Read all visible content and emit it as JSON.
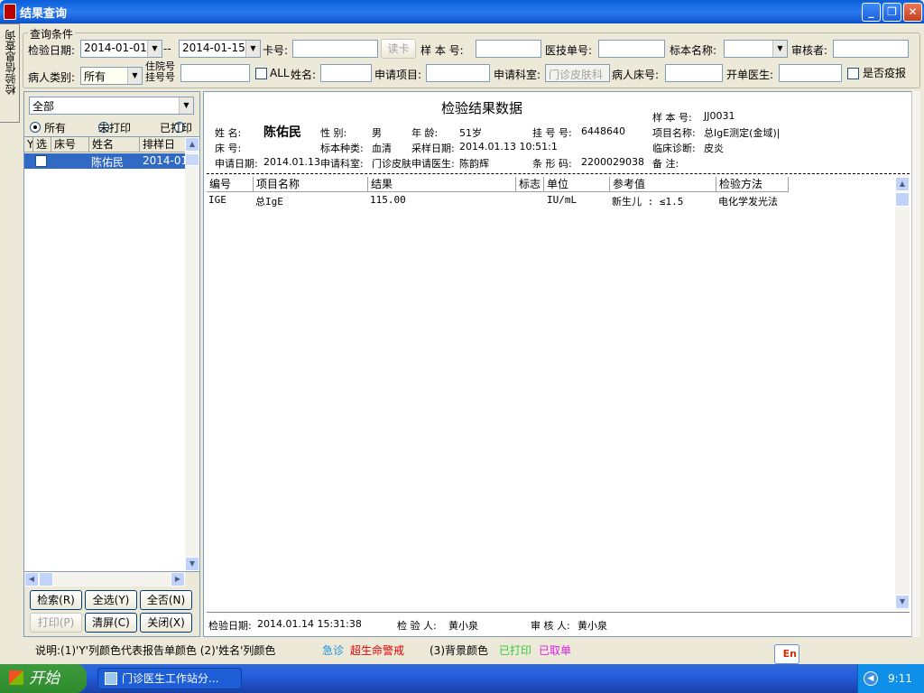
{
  "window": {
    "title": "结果查询",
    "minimize": "_",
    "maximize": "❐",
    "close": "✕"
  },
  "side_tab": "检验信息查询",
  "cond": {
    "legend": "查询条件",
    "date_label": "检验日期:",
    "date_from": "2014-01-01",
    "date_sep": "--",
    "date_to": "2014-01-15",
    "card_label": "卡号:",
    "card_value": "",
    "read_card": "读卡",
    "sample_label": "样 本 号:",
    "sample_value": "",
    "yj_label": "医技单号:",
    "yj_value": "",
    "specimen_name_label": "标本名称:",
    "specimen_name_value": "",
    "reviewer_label": "审核者:",
    "reviewer_value": "",
    "patient_type_label": "病人类别:",
    "patient_type_value": "所有",
    "inpatient_label_1": "住院号",
    "inpatient_label_2": "挂号号",
    "inpatient_value": "",
    "all_label": "ALL",
    "name_label": "姓名:",
    "name_value": "",
    "apply_item_label": "申请项目:",
    "apply_item_value": "",
    "apply_dept_label": "申请科室:",
    "apply_dept_value": "门诊皮肤科",
    "bed_label": "病人床号:",
    "bed_value": "",
    "doctor_label": "开单医生:",
    "doctor_value": "",
    "epidemic_label": "是否疫报"
  },
  "left": {
    "filter_value": "全部",
    "radio_all": "所有",
    "radio_unprinted": "未打印",
    "radio_printed": "已打印",
    "columns": [
      "Y",
      "选",
      "床号",
      "姓名",
      "排样日"
    ],
    "rows": [
      {
        "y": "",
        "bed": "",
        "name": "陈佑民",
        "date": "2014-01"
      }
    ],
    "buttons": {
      "search": "检索(R)",
      "select_all": "全选(Y)",
      "select_none": "全否(N)",
      "print": "打印(P)",
      "clear": "清屏(C)",
      "close": "关闭(X)"
    }
  },
  "report": {
    "title": "检验结果数据",
    "sample_no_label": "样 本 号:",
    "sample_no": "JJ0031",
    "name_label": "姓    名:",
    "name": "陈佑民",
    "sex_label": "性    别:",
    "sex": "男",
    "age_label": "年    龄:",
    "age": "51岁",
    "reg_label": "挂 号 号:",
    "reg": "6448640",
    "item_label": "项目名称:",
    "item": "总IgE测定(金域)|",
    "bed_label": "床    号:",
    "bed": "",
    "specimen_label": "标本种类:",
    "specimen": "血清",
    "collect_label": "采样日期:",
    "collect": "2014.01.13 10:51:1",
    "diag_label": "临床诊断:",
    "diag": "皮炎",
    "apply_date_label": "申请日期:",
    "apply_date": "2014.01.13",
    "apply_dept_label": "申请科室:",
    "apply_dept": "门诊皮肤",
    "apply_doc_label": "申请医生:",
    "apply_doc": "陈韵辉",
    "barcode_label": "条 形 码:",
    "barcode": "2200029038",
    "remark_label": "备    注:",
    "remark": "",
    "columns": [
      "编号",
      "项目名称",
      "结果",
      "标志",
      "单位",
      "参考值",
      "检验方法"
    ],
    "rows": [
      {
        "code": "IGE",
        "name": "总IgE",
        "result": "115.00",
        "flag": "",
        "unit": "IU/mL",
        "ref": "新生儿 : ≤1.5",
        "method": "电化学发光法"
      }
    ],
    "footer_date_label": "检验日期:",
    "footer_date": "2014.01.14 15:31:38",
    "tester_label": "检 验 人:",
    "tester": "黄小泉",
    "checker_label": "审 核 人:",
    "checker": "黄小泉"
  },
  "note": {
    "prefix": "说明:(1)'Y'列颜色代表报告单颜色  (2)'姓名'列颜色",
    "urgent": "急诊",
    "critical": "超生命警戒",
    "bg": "(3)背景颜色",
    "printed": "已打印",
    "cancelled": "已取单"
  },
  "ime": "En",
  "taskbar": {
    "start": "开始",
    "task": "门诊医生工作站分...",
    "clock": "9:11"
  },
  "colors": {
    "urgent": "#1e90d8",
    "critical": "#e00000",
    "printed": "#33cc33",
    "cancelled": "#e020e0",
    "selected_row": "#316ac5"
  }
}
